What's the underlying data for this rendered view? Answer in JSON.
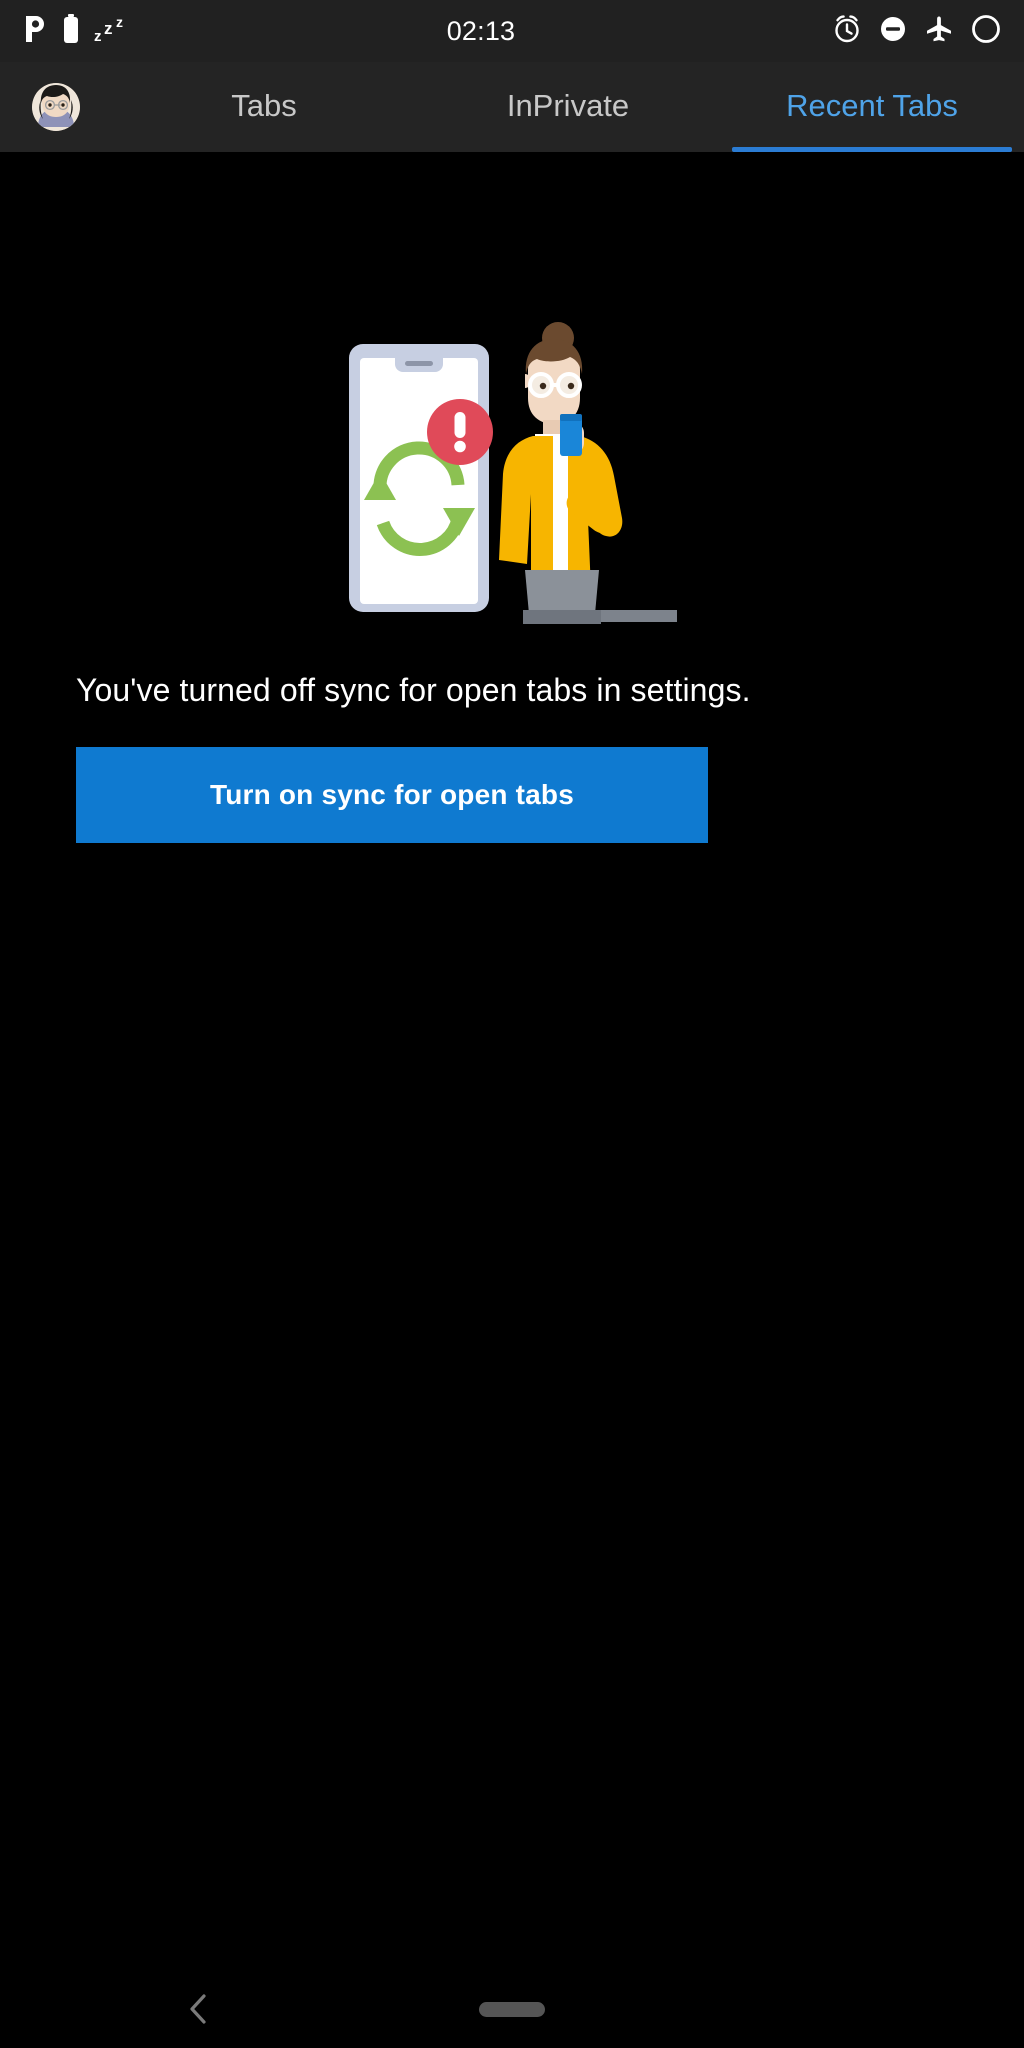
{
  "status_bar": {
    "clock": "02:13",
    "left_icons": [
      {
        "name": "pandora-icon",
        "glyph": "P"
      },
      {
        "name": "battery-icon",
        "glyph": "battery"
      },
      {
        "name": "sleep-mode-icon",
        "glyph": "zzz"
      }
    ],
    "right_icons": [
      {
        "name": "alarm-clock-icon",
        "glyph": "alarm"
      },
      {
        "name": "do-not-disturb-icon",
        "glyph": "minus-circle"
      },
      {
        "name": "airplane-mode-icon",
        "glyph": "airplane"
      },
      {
        "name": "signal-off-icon",
        "glyph": "circle"
      }
    ],
    "background_color": "#212121",
    "foreground_color": "#ffffff"
  },
  "tab_bar": {
    "avatar_label": "profile-avatar",
    "background_color": "#242424",
    "active_color": "#4fa3e8",
    "inactive_color": "#c8c8c8",
    "underline_color": "#2b7cd3",
    "tabs": [
      {
        "label": "Tabs",
        "active": false
      },
      {
        "label": "InPrivate",
        "active": false
      },
      {
        "label": "Recent Tabs",
        "active": true
      }
    ]
  },
  "main": {
    "background_color": "#000000",
    "illustration": {
      "name": "sync-error-illustration",
      "description": "Phone with green sync arrows and red error badge beside a person in a yellow jacket holding a blue cup",
      "colors": {
        "phone_body": "#c7cfe2",
        "phone_screen": "#ffffff",
        "phone_speaker": "#8d95a8",
        "sync_arrows": "#8cc152",
        "error_badge": "#e04a59",
        "error_mark": "#ffffff",
        "jacket": "#f7b500",
        "shirt": "#ffffff",
        "pants": "#8b9199",
        "hair": "#6b4a2f",
        "skin": "#f2d9c4",
        "glasses": "#ffffff",
        "cup": "#1a86d8"
      }
    },
    "message": "You've turned off sync for open tabs in settings.",
    "primary_button": {
      "label": "Turn on sync for open tabs",
      "background_color": "#0f7ad0",
      "text_color": "#ffffff"
    }
  },
  "nav_bar": {
    "background_color": "#000000",
    "back_label": "back-button",
    "home_label": "home-pill",
    "icon_color": "#7a7a7a"
  }
}
